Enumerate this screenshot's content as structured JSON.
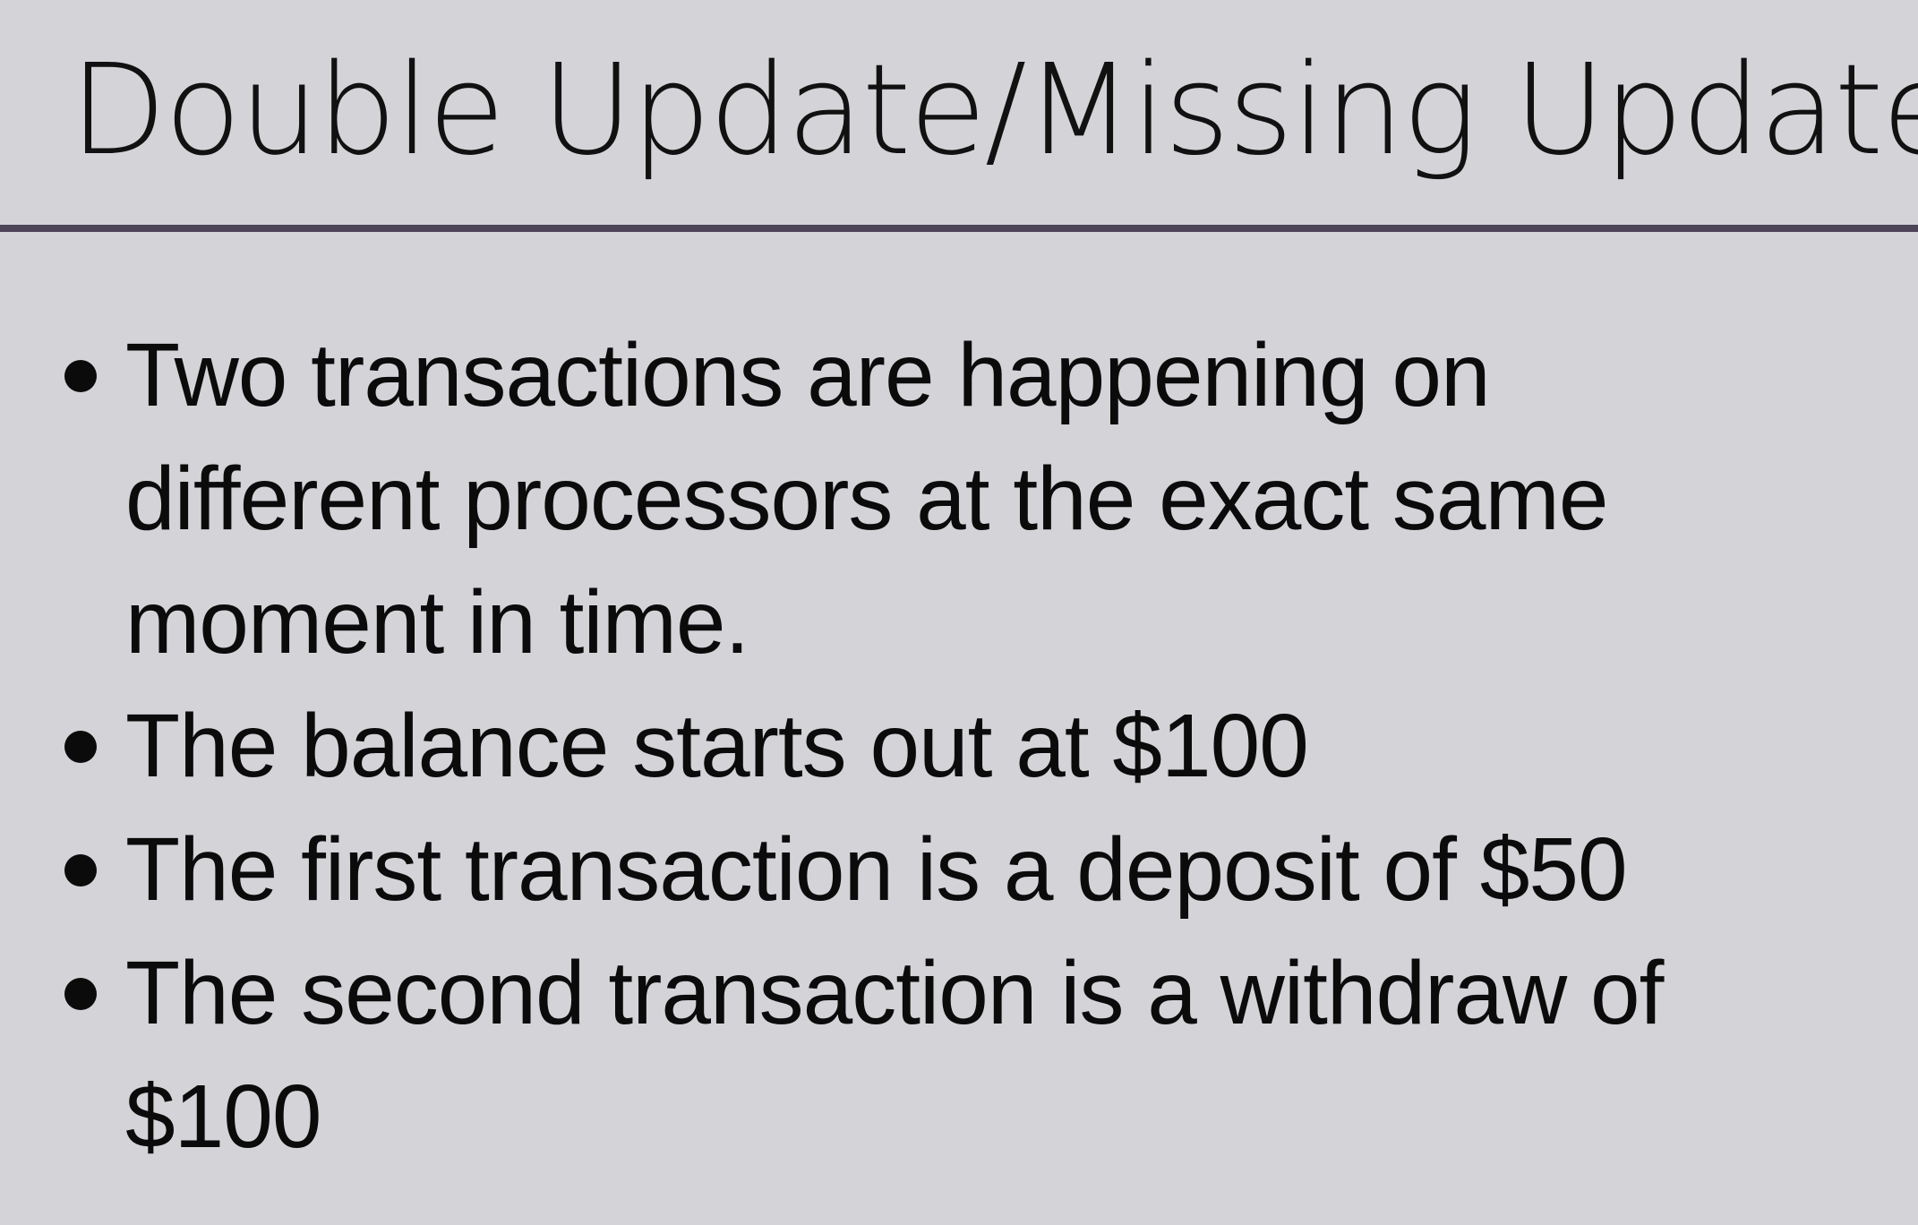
{
  "slide": {
    "title": "Double Update/Missing Update",
    "bullets": [
      {
        "lines": [
          "Two transactions are happening on",
          "different processors at the exact same",
          "moment in time."
        ]
      },
      {
        "lines": [
          "The balance starts out at $100"
        ]
      },
      {
        "lines": [
          "The first transaction is a deposit of $50"
        ]
      },
      {
        "lines": [
          "The second transaction is a withdraw of",
          "$100"
        ]
      }
    ]
  },
  "colors": {
    "background": "#d3d3d8",
    "divider": "#4d4458",
    "text": "#0b0b0b"
  }
}
